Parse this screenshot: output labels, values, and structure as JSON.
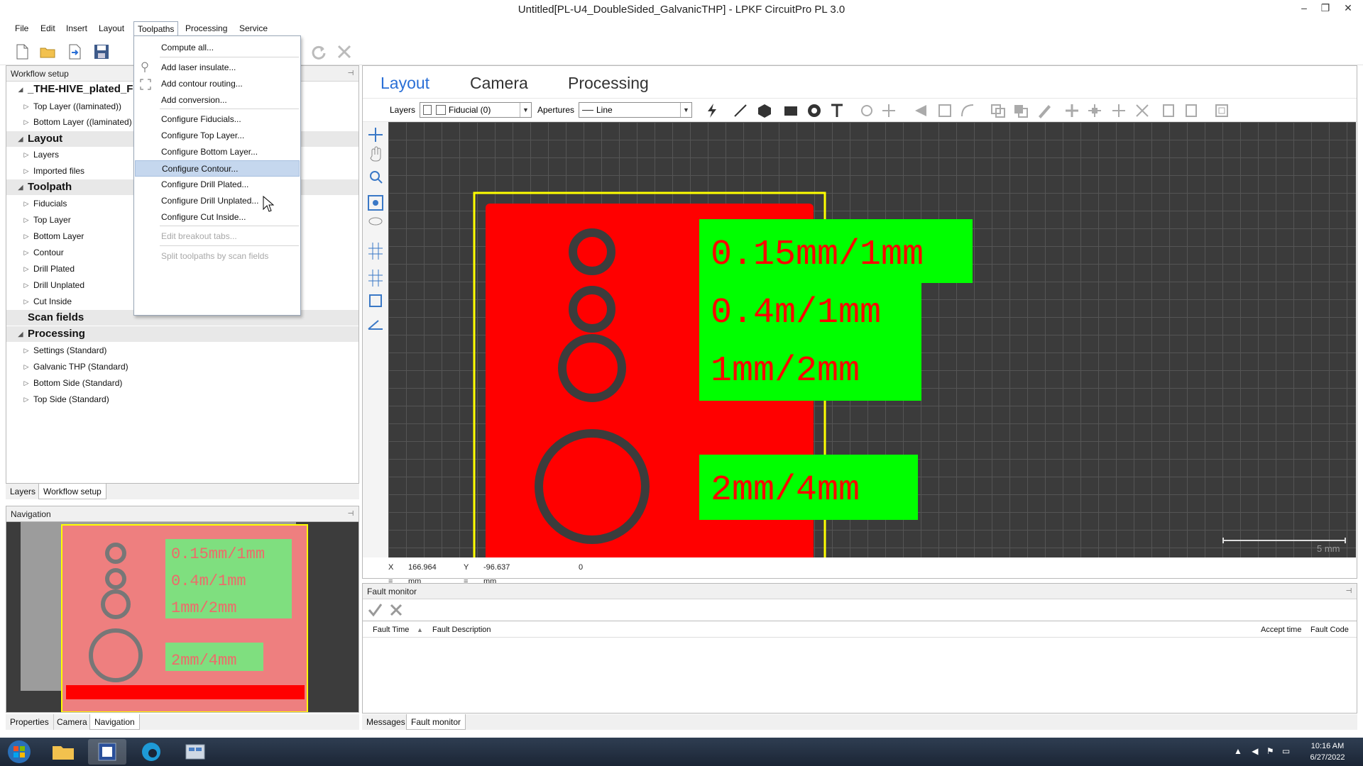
{
  "window": {
    "title": "Untitled[PL-U4_DoubleSided_GalvanicTHP] - LPKF CircuitPro PL 3.0",
    "controls": [
      "–",
      "❐",
      "✕"
    ]
  },
  "menubar": [
    "File",
    "Edit",
    "Insert",
    "Layout",
    "Toolpaths",
    "Processing",
    "Service"
  ],
  "toolpaths_menu": {
    "items": [
      {
        "label": "Compute all...",
        "enabled": true
      },
      {
        "label": "Add laser insulate...",
        "enabled": true
      },
      {
        "label": "Add contour routing...",
        "enabled": true
      },
      {
        "label": "Add conversion...",
        "enabled": true
      },
      {
        "label": "Configure Fiducials...",
        "enabled": true
      },
      {
        "label": "Configure Top Layer...",
        "enabled": true
      },
      {
        "label": "Configure Bottom Layer...",
        "enabled": true
      },
      {
        "label": "Configure Contour...",
        "enabled": true,
        "highlighted": true
      },
      {
        "label": "Configure Drill Plated...",
        "enabled": true
      },
      {
        "label": "Configure Drill Unplated...",
        "enabled": true
      },
      {
        "label": "Configure Cut Inside...",
        "enabled": true
      },
      {
        "label": "Edit breakout tabs...",
        "enabled": false
      },
      {
        "label": "Split toolpaths by scan fields",
        "enabled": false
      }
    ]
  },
  "workflow": {
    "header": "Workflow setup",
    "rows": [
      {
        "label": "_THE-HIVE_plated_F",
        "level": 0,
        "cat": false,
        "bold": true
      },
      {
        "label": "Top Layer ((laminated))",
        "level": 1
      },
      {
        "label": "Bottom Layer ((laminated)",
        "level": 1
      },
      {
        "label": "Layout",
        "level": 0,
        "cat": true
      },
      {
        "label": "Layers",
        "level": 1
      },
      {
        "label": "Imported files",
        "level": 1
      },
      {
        "label": "Toolpath",
        "level": 0,
        "cat": true
      },
      {
        "label": "Fiducials",
        "level": 1
      },
      {
        "label": "Top Layer",
        "level": 1
      },
      {
        "label": "Bottom Layer",
        "level": 1
      },
      {
        "label": "Contour",
        "level": 1
      },
      {
        "label": "Drill Plated",
        "level": 1
      },
      {
        "label": "Drill Unplated",
        "level": 1
      },
      {
        "label": "Cut Inside",
        "level": 1
      },
      {
        "label": "Scan fields",
        "level": 0,
        "cat": true
      },
      {
        "label": "Processing",
        "level": 0,
        "cat": true
      },
      {
        "label": "Settings (Standard)",
        "level": 1
      },
      {
        "label": "Galvanic THP (Standard)",
        "level": 1
      },
      {
        "label": "Bottom Side (Standard)",
        "level": 1
      },
      {
        "label": "Top Side (Standard)",
        "level": 1
      }
    ],
    "tabs": [
      "Layers",
      "Workflow setup"
    ]
  },
  "navigation": {
    "header": "Navigation",
    "tabs": [
      "Properties",
      "Camera",
      "Navigation"
    ]
  },
  "main": {
    "tabs": [
      "Layout",
      "Camera",
      "Processing"
    ],
    "layers_label": "Layers",
    "layer_value": "Fiducial (0)",
    "apertures_label": "Apertures",
    "aperture_value": "Line",
    "board_labels": [
      "0.15mm/1mm",
      "0.4m/1mm",
      "1mm/2mm",
      "2mm/4mm"
    ],
    "scale_label": "5 mm",
    "coords": {
      "x_label": "X =",
      "x": "166.964 mm",
      "y_label": "Y =",
      "y": "-96.637 mm",
      "extra": "0"
    }
  },
  "fault_monitor": {
    "header": "Fault monitor",
    "columns": [
      "Fault Time",
      "Fault Description",
      "Accept time",
      "Fault Code"
    ],
    "tabs": [
      "Messages",
      "Fault monitor"
    ]
  },
  "taskbar": {
    "time": "10:16 AM",
    "date": "6/27/2022"
  },
  "colors": {
    "board": "#ff0000",
    "label_bg": "#00ff00",
    "outline": "#ffff00",
    "accent": "#2a6fd6",
    "canvas": "#3b3b3b"
  }
}
